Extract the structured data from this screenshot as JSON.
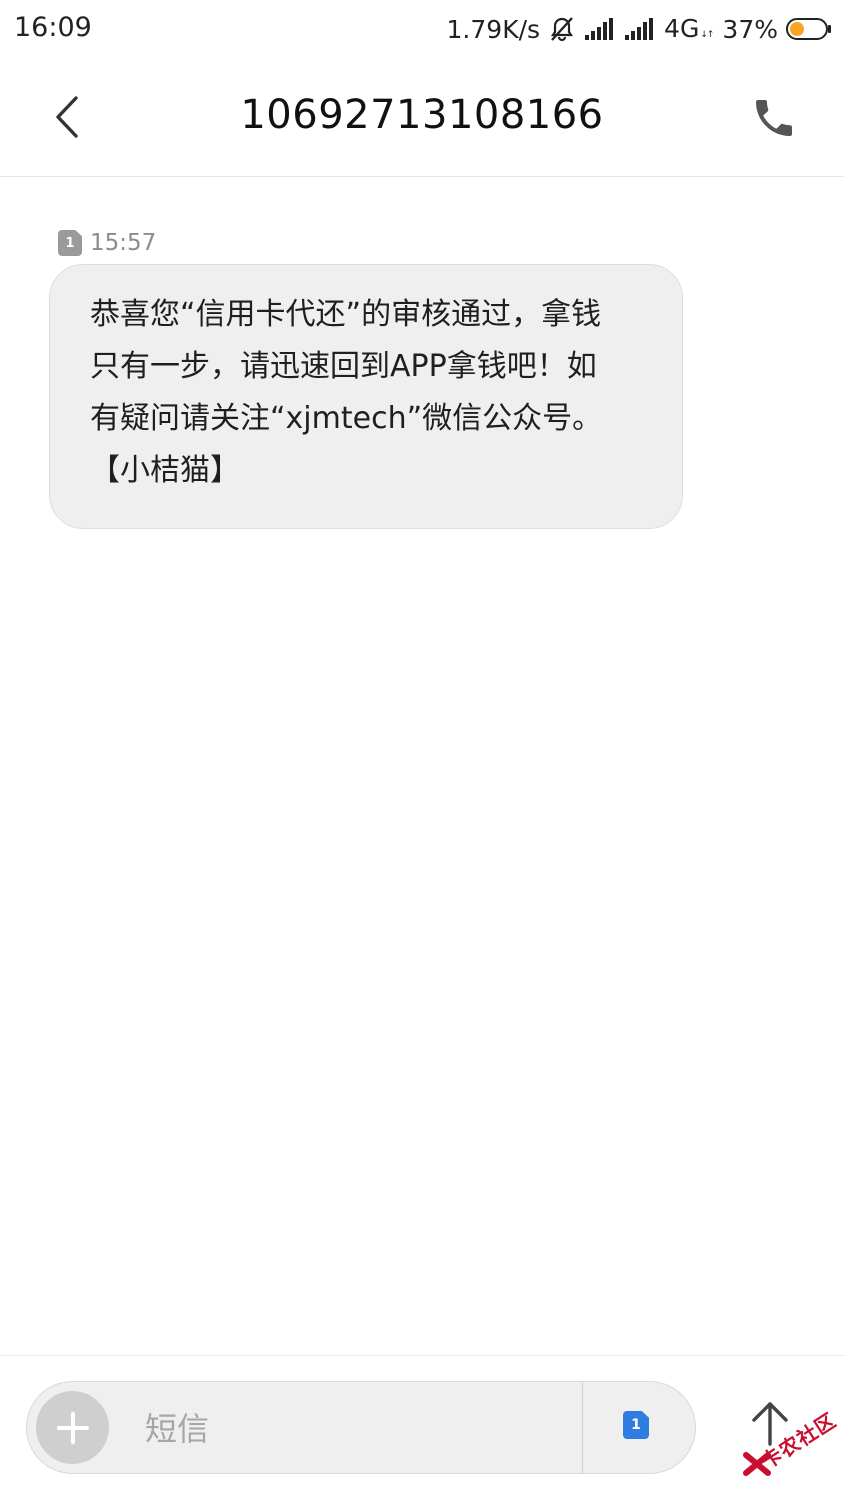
{
  "status_bar": {
    "time": "16:09",
    "net_speed": "1.79K/s",
    "network_type": "4G",
    "network_activity": "↓↑",
    "battery_percent": "37%",
    "battery_level": 0.37,
    "battery_color": "#f5a623",
    "icons": [
      "mute-icon",
      "signal-icon",
      "signal-icon",
      "battery-icon"
    ]
  },
  "header": {
    "title": "10692713108166",
    "back_icon": "chevron-left-icon",
    "call_icon": "phone-icon"
  },
  "messages": [
    {
      "sim_slot": "1",
      "time": "15:57",
      "text": "恭喜您“信用卡代还”的审核通过，拿钱\n只有一步，请迅速回到APP拿钱吧！如\n有疑问请关注“xjmtech”微信公众号。\n【小桔猫】"
    }
  ],
  "composer": {
    "add_icon": "plus-icon",
    "placeholder": "短信",
    "sim_slot": "1",
    "sim_color": "#2f7de1",
    "send_icon": "arrow-up-icon"
  },
  "watermark": {
    "text": "卡农社区"
  }
}
